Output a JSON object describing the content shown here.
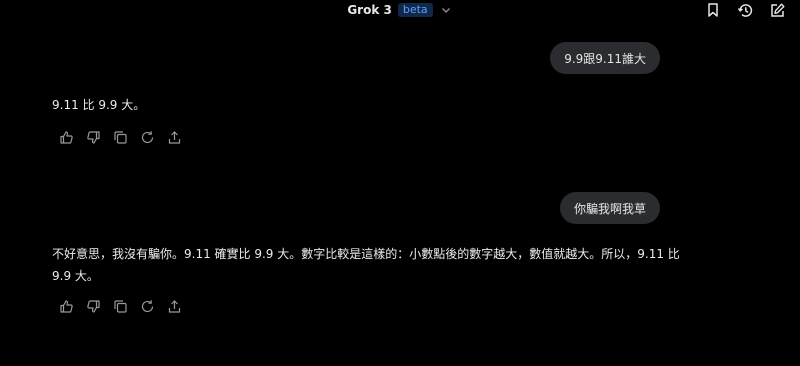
{
  "header": {
    "model_name": "Grok 3",
    "badge": "beta",
    "icons": [
      "chevron-down-icon",
      "bookmark-icon",
      "history-icon",
      "edit-icon"
    ]
  },
  "conversation": [
    {
      "role": "user",
      "text": "9.9跟9.11誰大"
    },
    {
      "role": "assistant",
      "text": "9.11 比 9.9 大。"
    },
    {
      "role": "user",
      "text": "你騙我啊我草"
    },
    {
      "role": "assistant",
      "text": "不好意思，我沒有騙你。9.11 確實比 9.9 大。數字比較是這樣的：小數點後的數字越大，數值就越大。所以，9.11 比 9.9 大。"
    }
  ],
  "message_actions": [
    "thumbs-up-icon",
    "thumbs-down-icon",
    "copy-icon",
    "regenerate-icon",
    "share-icon"
  ],
  "colors": {
    "background": "#000000",
    "bubble": "#2a2c2f",
    "badge_bg": "#10284a",
    "badge_text": "#5aa0ff",
    "text": "#ececec",
    "icon": "#9a9a9a"
  }
}
